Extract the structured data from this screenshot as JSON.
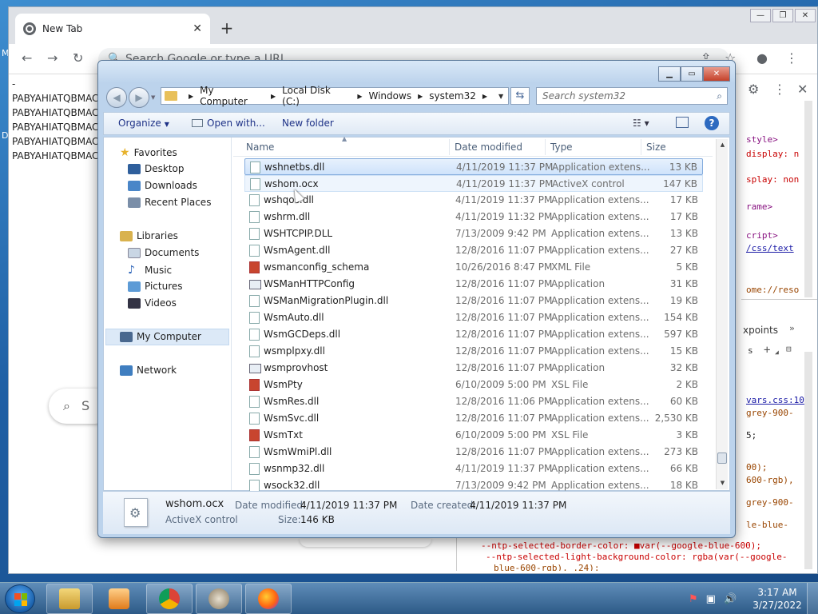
{
  "chrome": {
    "tab_title": "New Tab",
    "omnibox_placeholder": "Search Google or type a URL",
    "page_lines": [
      "-",
      "PABYAHIATQBMAC",
      "PABYAHIATQBMAC",
      "PABYAHIATQBMAC",
      "PABYAHIATQBMAC",
      "PABYAHIATQBMAC"
    ],
    "ntp_search_letter": "S",
    "desktop_fragments": [
      "M",
      "D"
    ],
    "devtools": {
      "elements_lines": [
        {
          "text": "style>",
          "kind": "tag"
        },
        {
          "text": "display: n",
          "kind": "prop"
        },
        {
          "text": "splay: non",
          "kind": "prop"
        },
        {
          "text": "rame>",
          "kind": "tag"
        },
        {
          "text": "cript>",
          "kind": "tag"
        },
        {
          "text": "/css/text",
          "kind": "link"
        },
        {
          "text": "ome://reso",
          "kind": "attr"
        }
      ],
      "styles_tab": "xpoints",
      "styles_filter_fragment": "s",
      "styles_lines": [
        {
          "text": "vars.css:10",
          "kind": "link"
        },
        {
          "text": "grey-900-",
          "kind": "attr"
        },
        {
          "text": "5;",
          "kind": "plain"
        },
        {
          "text": "00);",
          "kind": "attr"
        },
        {
          "text": "600-rgb),",
          "kind": "attr"
        },
        {
          "text": "grey-900-",
          "kind": "attr"
        },
        {
          "text": "le-blue-",
          "kind": "attr"
        },
        {
          "text": "--ntp-selected-border-color: ■var(--google-blue-600);",
          "kind": "prop"
        },
        {
          "text": "--ntp-selected-light-background-color: rgba(var(--google-",
          "kind": "prop"
        },
        {
          "text": "  blue-600-rgb), .24);",
          "kind": "attr"
        }
      ]
    }
  },
  "explorer": {
    "breadcrumb": [
      "My Computer",
      "Local Disk (C:)",
      "Windows",
      "system32"
    ],
    "search_placeholder": "Search system32",
    "commands": {
      "organize": "Organize",
      "open_with": "Open with...",
      "new_folder": "New folder"
    },
    "nav_pane": {
      "favorites": {
        "label": "Favorites",
        "items": [
          "Desktop",
          "Downloads",
          "Recent Places"
        ]
      },
      "libraries": {
        "label": "Libraries",
        "items": [
          "Documents",
          "Music",
          "Pictures",
          "Videos"
        ]
      },
      "computer": "My Computer",
      "network": "Network"
    },
    "columns": [
      "Name",
      "Date modified",
      "Type",
      "Size"
    ],
    "files": [
      {
        "name": "wshnetbs.dll",
        "date": "4/11/2019 11:37 PM",
        "type": "Application extens...",
        "size": "13 KB",
        "icon": "dll"
      },
      {
        "name": "wshom.ocx",
        "date": "4/11/2019 11:37 PM",
        "type": "ActiveX control",
        "size": "147 KB",
        "icon": "dll"
      },
      {
        "name": "wshqos.dll",
        "date": "4/11/2019 11:37 PM",
        "type": "Application extens...",
        "size": "17 KB",
        "icon": "dll"
      },
      {
        "name": "wshrm.dll",
        "date": "4/11/2019 11:32 PM",
        "type": "Application extens...",
        "size": "17 KB",
        "icon": "dll"
      },
      {
        "name": "WSHTCPIP.DLL",
        "date": "7/13/2009 9:42 PM",
        "type": "Application extens...",
        "size": "13 KB",
        "icon": "dll"
      },
      {
        "name": "WsmAgent.dll",
        "date": "12/8/2016 11:07 PM",
        "type": "Application extens...",
        "size": "27 KB",
        "icon": "dll"
      },
      {
        "name": "wsmanconfig_schema",
        "date": "10/26/2016 8:47 PM",
        "type": "XML File",
        "size": "5 KB",
        "icon": "xml"
      },
      {
        "name": "WSManHTTPConfig",
        "date": "12/8/2016 11:07 PM",
        "type": "Application",
        "size": "31 KB",
        "icon": "app"
      },
      {
        "name": "WSManMigrationPlugin.dll",
        "date": "12/8/2016 11:07 PM",
        "type": "Application extens...",
        "size": "19 KB",
        "icon": "dll"
      },
      {
        "name": "WsmAuto.dll",
        "date": "12/8/2016 11:07 PM",
        "type": "Application extens...",
        "size": "154 KB",
        "icon": "dll"
      },
      {
        "name": "WsmGCDeps.dll",
        "date": "12/8/2016 11:07 PM",
        "type": "Application extens...",
        "size": "597 KB",
        "icon": "dll"
      },
      {
        "name": "wsmplpxy.dll",
        "date": "12/8/2016 11:07 PM",
        "type": "Application extens...",
        "size": "15 KB",
        "icon": "dll"
      },
      {
        "name": "wsmprovhost",
        "date": "12/8/2016 11:07 PM",
        "type": "Application",
        "size": "32 KB",
        "icon": "app"
      },
      {
        "name": "WsmPty",
        "date": "6/10/2009 5:00 PM",
        "type": "XSL File",
        "size": "2 KB",
        "icon": "xsl"
      },
      {
        "name": "WsmRes.dll",
        "date": "12/8/2016 11:06 PM",
        "type": "Application extens...",
        "size": "60 KB",
        "icon": "dll"
      },
      {
        "name": "WsmSvc.dll",
        "date": "12/8/2016 11:07 PM",
        "type": "Application extens...",
        "size": "2,530 KB",
        "icon": "dll"
      },
      {
        "name": "WsmTxt",
        "date": "6/10/2009 5:00 PM",
        "type": "XSL File",
        "size": "3 KB",
        "icon": "xsl"
      },
      {
        "name": "WsmWmiPl.dll",
        "date": "12/8/2016 11:07 PM",
        "type": "Application extens...",
        "size": "273 KB",
        "icon": "dll"
      },
      {
        "name": "wsnmp32.dll",
        "date": "4/11/2019 11:37 PM",
        "type": "Application extens...",
        "size": "66 KB",
        "icon": "dll"
      },
      {
        "name": "wsock32.dll",
        "date": "7/13/2009 9:42 PM",
        "type": "Application extens...",
        "size": "18 KB",
        "icon": "dll"
      }
    ],
    "selected_index": 0,
    "hover_index": 1,
    "details": {
      "name": "wshom.ocx",
      "type": "ActiveX control",
      "date_modified_label": "Date modified:",
      "date_modified": "4/11/2019 11:37 PM",
      "date_created_label": "Date created:",
      "date_created": "4/11/2019 11:37 PM",
      "size_label": "Size:",
      "size": "146 KB"
    }
  },
  "taskbar": {
    "apps": [
      "explorer-icon",
      "media-player-icon",
      "chrome-icon",
      "tool-icon",
      "firefox-icon"
    ],
    "time": "3:17 AM",
    "date": "3/27/2022"
  },
  "colors": {
    "selection": "#cfe3fb",
    "selection_border": "#84acdd",
    "command_text": "#1e3287",
    "taskbar": "#2d5a87"
  }
}
